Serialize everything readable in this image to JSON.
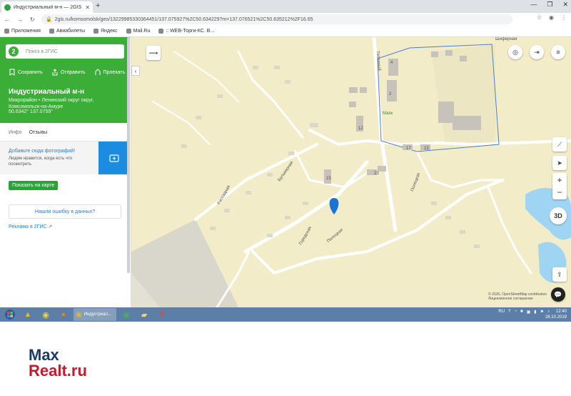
{
  "browser": {
    "tab_title": "Индустриальный м-н — 2GIS",
    "new_tab": "+",
    "url": "2gis.ru/komsomolsk/geo/13229985330364451/137.075927%2C50.634229?m=137.076521%2C50.635212%2F16.65",
    "bookmarks": [
      "Приложения",
      "Авиабилеты",
      "Яндекс",
      "Mail.Ru",
      ":: WEB-Торги-КС. В..."
    ]
  },
  "sidebar": {
    "search_placeholder": "Поиск в 2ГИС",
    "logo": "2",
    "actions": [
      "Сохранить",
      "Отправить",
      "Проехать"
    ],
    "title": "Индустриальный м-н",
    "subtitle": "Микрорайон • Ленинский округ округ, Комсомольск-на-Амуре",
    "coords": "50.6342° 137.0759°",
    "tabs": [
      "Инфо",
      "Отзывы"
    ],
    "photo_title": "Добавьте сюда фотографий!",
    "photo_text": "Людям нравится, когда есть что посмотреть",
    "show_on_map": "Показать на карте",
    "found_error": "Нашли ошибку в данных?",
    "ad_link": "Реклама в 2ГИС ↗"
  },
  "map": {
    "streets": [
      "Шиферная",
      "Теплиный",
      "Бульварная",
      "Рассадная",
      "Городская",
      "Полоцкая",
      "Полоцкая"
    ],
    "house_numbers": [
      "4",
      "2",
      "12",
      "17",
      "13",
      "23",
      "15"
    ],
    "poi": "Маяк",
    "attribution": "© 2GIS, OpenStreetMap contributors",
    "license": "Лицензионное соглашение",
    "btn_3d": "3D"
  },
  "taskbar": {
    "active_app": "Индустриал...",
    "lang": "RU",
    "time": "12:40",
    "date": "28.10.2019"
  },
  "watermark": {
    "line1": "Max",
    "line2": "Realt.ru"
  }
}
